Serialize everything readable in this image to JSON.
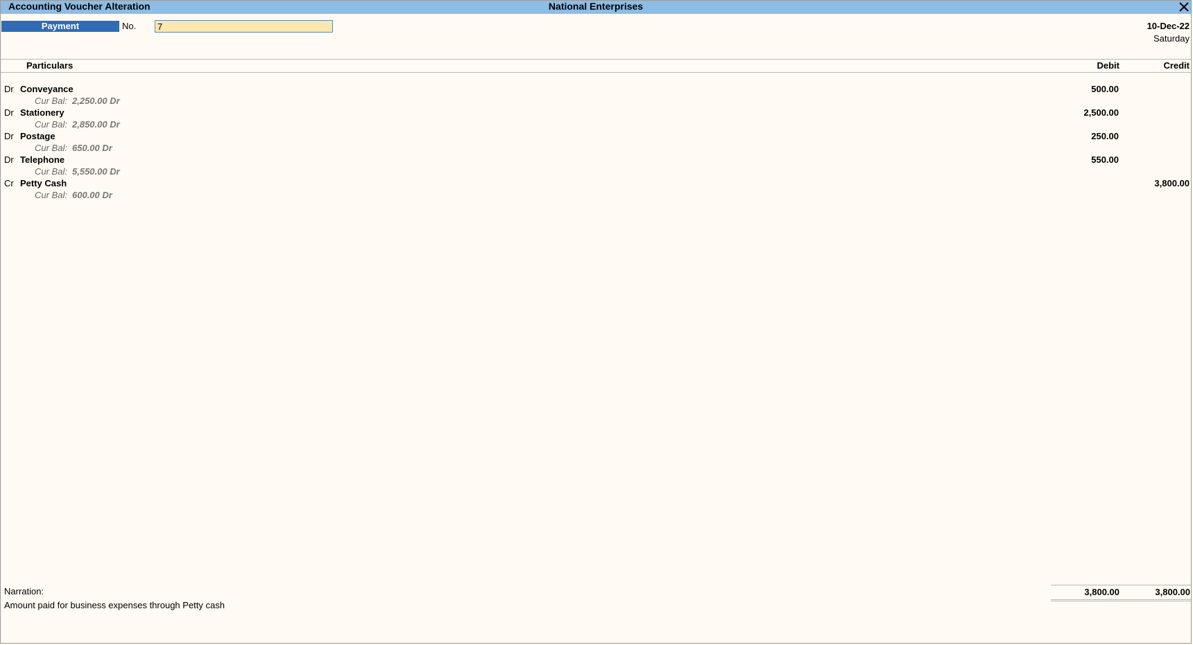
{
  "window": {
    "title": "Accounting Voucher Alteration",
    "company": "National Enterprises",
    "close_icon": "close-icon"
  },
  "voucher": {
    "type": "Payment",
    "no_label": "No.",
    "number": "7",
    "date": "10-Dec-22",
    "day": "Saturday"
  },
  "columns": {
    "particulars": "Particulars",
    "debit": "Debit",
    "credit": "Credit"
  },
  "entries": [
    {
      "drcr": "Dr",
      "ledger": "Conveyance",
      "bal_label": "Cur Bal:",
      "bal_value": "2,250.00 Dr",
      "debit": "500.00",
      "credit": ""
    },
    {
      "drcr": "Dr",
      "ledger": "Stationery",
      "bal_label": "Cur Bal:",
      "bal_value": "2,850.00 Dr",
      "debit": "2,500.00",
      "credit": ""
    },
    {
      "drcr": "Dr",
      "ledger": "Postage",
      "bal_label": "Cur Bal:",
      "bal_value": "650.00 Dr",
      "debit": "250.00",
      "credit": ""
    },
    {
      "drcr": "Dr",
      "ledger": "Telephone",
      "bal_label": "Cur Bal:",
      "bal_value": "5,550.00 Dr",
      "debit": "550.00",
      "credit": ""
    },
    {
      "drcr": "Cr",
      "ledger": "Petty Cash",
      "bal_label": "Cur Bal:",
      "bal_value": "600.00 Dr",
      "debit": "",
      "credit": "3,800.00"
    }
  ],
  "narration": {
    "label": "Narration:",
    "text": "Amount paid for business expenses through Petty cash"
  },
  "totals": {
    "debit": "3,800.00",
    "credit": "3,800.00"
  },
  "colors": {
    "titlebar": "#8dbce4",
    "voucher_type_bg": "#2f6cb5",
    "input_bg": "#fce6b1",
    "background": "#fffaf3"
  }
}
